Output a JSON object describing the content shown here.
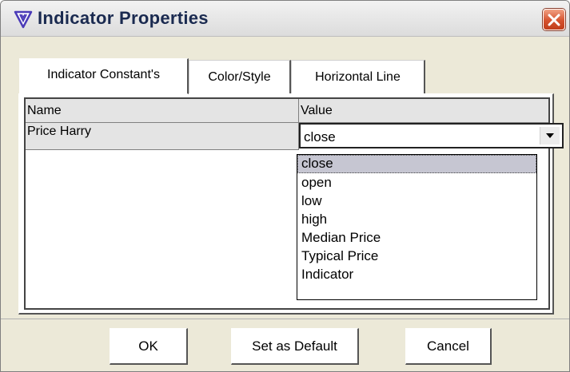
{
  "window": {
    "title": "Indicator Properties",
    "title_icon": "indicator-logo-icon",
    "close_icon": "close-icon"
  },
  "tabs": [
    {
      "label": "Indicator Constant's",
      "active": true
    },
    {
      "label": "Color/Style",
      "active": false
    },
    {
      "label": "Horizontal Line",
      "active": false
    }
  ],
  "table": {
    "headers": {
      "name": "Name",
      "value": "Value"
    },
    "rows": [
      {
        "name": "Price Harry",
        "value": "close"
      }
    ]
  },
  "dropdown": {
    "options": [
      "close",
      "open",
      "low",
      "high",
      "Median Price",
      "Typical Price",
      "Indicator"
    ],
    "selected": "close"
  },
  "buttons": {
    "ok": "OK",
    "set_default": "Set as Default",
    "cancel": "Cancel"
  },
  "colors": {
    "dialog_bg": "#ece9d8",
    "close_button": "#d5522e",
    "selection_highlight": "#c6c6d2",
    "logo": "#4b3bb8"
  }
}
